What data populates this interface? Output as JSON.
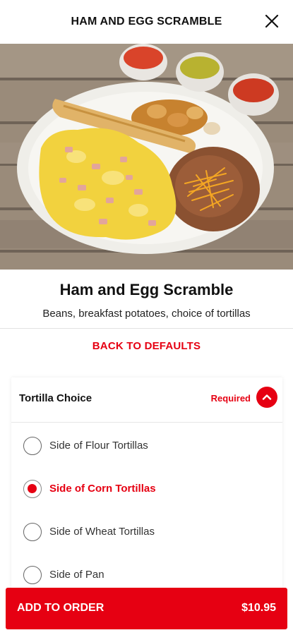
{
  "header": {
    "title": "HAM AND EGG SCRAMBLE"
  },
  "item": {
    "title": "Ham and Egg Scramble",
    "description": "Beans, breakfast potatoes, choice of tortillas"
  },
  "actions": {
    "back_to_defaults": "BACK TO DEFAULTS"
  },
  "option_group": {
    "title": "Tortilla Choice",
    "required_label": "Required",
    "options": [
      {
        "label": "Side of Flour Tortillas",
        "selected": false
      },
      {
        "label": "Side of Corn Tortillas",
        "selected": true
      },
      {
        "label": "Side of Wheat Tortillas",
        "selected": false
      },
      {
        "label": "Side of Pan",
        "selected": false
      }
    ]
  },
  "footer": {
    "add_label": "ADD TO ORDER",
    "price": "$10.95"
  },
  "colors": {
    "accent": "#e60012"
  },
  "icons": {
    "close": "close-icon",
    "collapse": "chevron-up-icon"
  }
}
